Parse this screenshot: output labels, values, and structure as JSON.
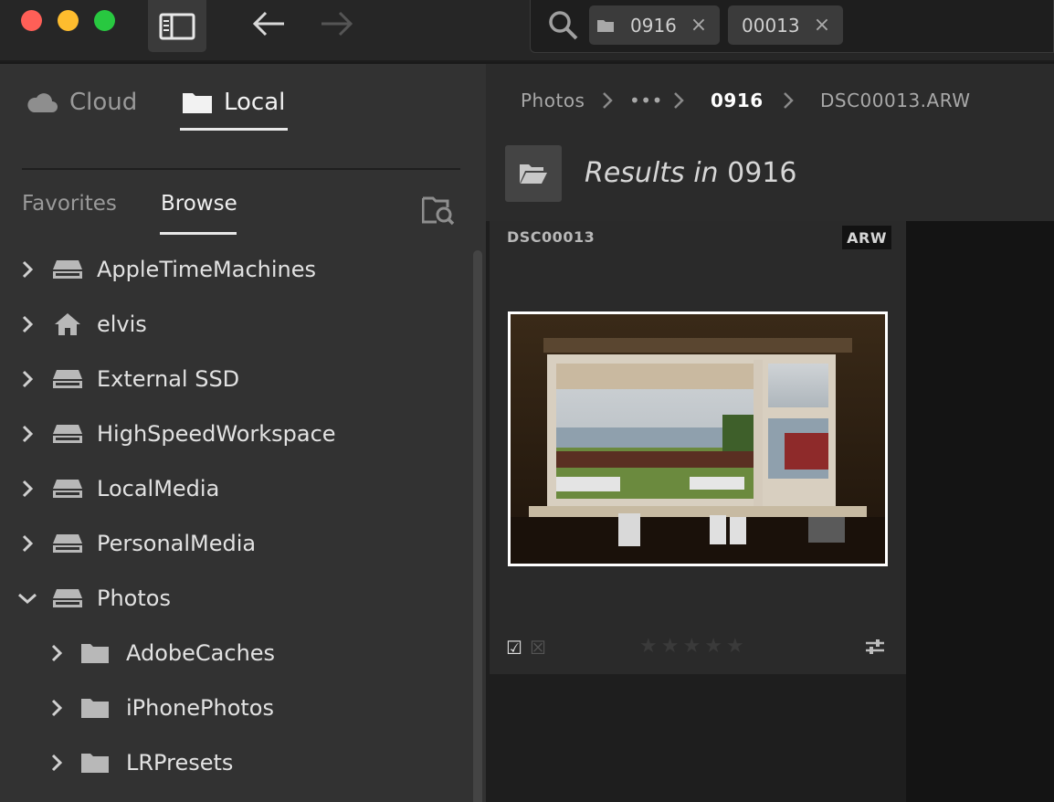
{
  "toolbar": {
    "search_chips": [
      {
        "label": "0916",
        "has_folder_icon": true
      },
      {
        "label": "00013",
        "has_folder_icon": false
      }
    ],
    "chip_close": "×"
  },
  "sidebar": {
    "source_tabs": {
      "cloud": "Cloud",
      "local": "Local",
      "active": "local"
    },
    "sub_tabs": {
      "favorites": "Favorites",
      "browse": "Browse",
      "active": "browse"
    },
    "tree": [
      {
        "label": "AppleTimeMachines",
        "icon": "drive-icon",
        "expanded": false,
        "level": 0
      },
      {
        "label": "elvis",
        "icon": "home-icon",
        "expanded": false,
        "level": 0
      },
      {
        "label": "External SSD",
        "icon": "drive-icon",
        "expanded": false,
        "level": 0
      },
      {
        "label": "HighSpeedWorkspace",
        "icon": "drive-icon",
        "expanded": false,
        "level": 0
      },
      {
        "label": "LocalMedia",
        "icon": "drive-icon",
        "expanded": false,
        "level": 0
      },
      {
        "label": "PersonalMedia",
        "icon": "drive-icon",
        "expanded": false,
        "level": 0
      },
      {
        "label": "Photos",
        "icon": "drive-icon",
        "expanded": true,
        "level": 0
      },
      {
        "label": "AdobeCaches",
        "icon": "folder-icon",
        "expanded": false,
        "level": 1
      },
      {
        "label": "iPhonePhotos",
        "icon": "folder-icon",
        "expanded": false,
        "level": 1
      },
      {
        "label": "LRPresets",
        "icon": "folder-icon",
        "expanded": false,
        "level": 1
      }
    ]
  },
  "breadcrumb": {
    "items": [
      "Photos",
      "•••",
      "0916",
      "DSC00013.ARW"
    ],
    "active_index": 2
  },
  "results": {
    "prefix": "Results in",
    "folder": "0916"
  },
  "photo_card": {
    "name": "DSC00013",
    "extension": "ARW",
    "rating": 0,
    "max_rating": 5,
    "flag_pick": "☑",
    "flag_reject": "☒",
    "star_glyph": "★"
  },
  "colors": {
    "accent_white": "#ffffff",
    "panel_bg": "#323232",
    "titlebar_bg": "#262626",
    "traffic_red": "#ff5f57",
    "traffic_yellow": "#febc2e",
    "traffic_green": "#28c840"
  }
}
